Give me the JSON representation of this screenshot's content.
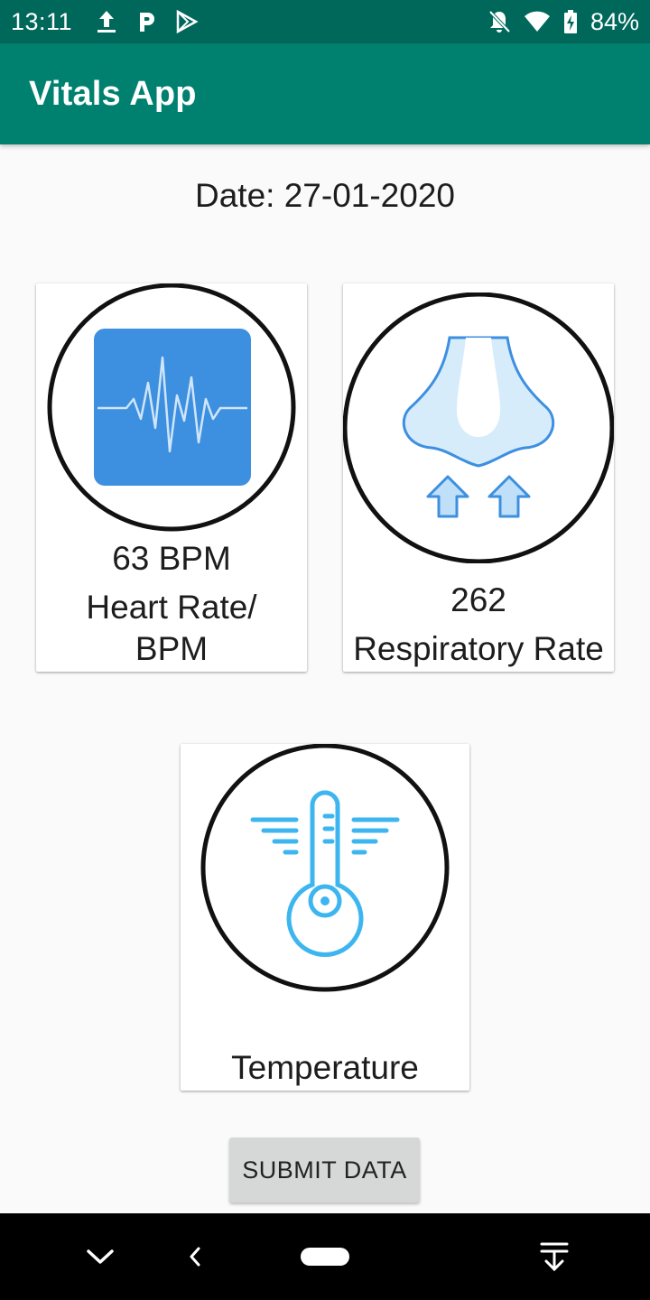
{
  "status_bar": {
    "time": "13:11",
    "battery": "84%",
    "icons": [
      "upload-icon",
      "parking-icon",
      "play-store-icon",
      "notifications-off-icon",
      "wifi-icon",
      "battery-charging-icon"
    ]
  },
  "app_bar": {
    "title": "Vitals App"
  },
  "main": {
    "date": "Date: 27-01-2020",
    "cards": {
      "heart": {
        "value": "63 BPM",
        "caption_line1": "Heart Rate/",
        "caption_line2": "BPM",
        "icon": "heartbeat-monitor-icon"
      },
      "resp": {
        "value": "262",
        "caption": "Respiratory Rate",
        "icon": "nose-breathing-icon"
      },
      "temp": {
        "value": "",
        "caption": "Temperature",
        "icon": "thermometer-icon"
      }
    },
    "submit_label": "SUBMIT DATA"
  },
  "nav_bar": {
    "icons": [
      "chevron-down-icon",
      "back-icon",
      "home-pill-icon",
      "notifications-expand-icon"
    ]
  },
  "colors": {
    "status_bar": "#00685B",
    "app_bar": "#00806F",
    "icon_blue": "#3D8FE0",
    "icon_light_blue": "#D6ECFB"
  }
}
